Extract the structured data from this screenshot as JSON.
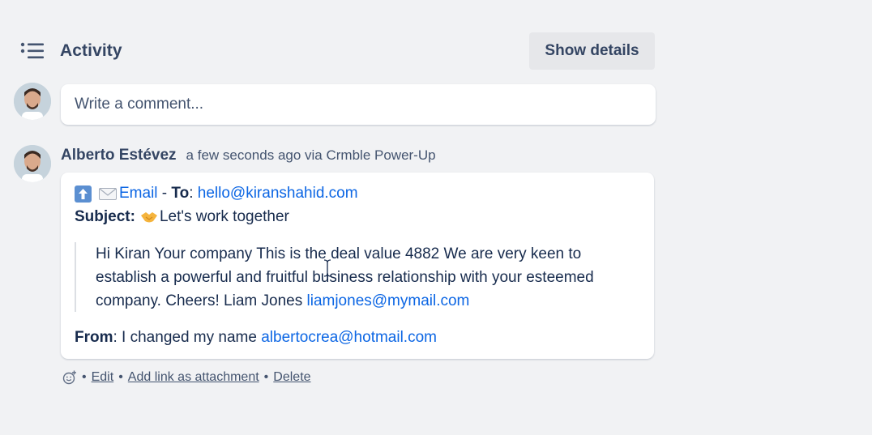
{
  "activity": {
    "title": "Activity",
    "show_details_label": "Show details"
  },
  "comment": {
    "placeholder": "Write a comment..."
  },
  "entry": {
    "author": "Alberto Estévez",
    "timestamp": "a few seconds ago via Crmble Power-Up",
    "email": {
      "type_label": "Email",
      "to_separator": " - ",
      "to_label": "To",
      "to_address": "hello@kiranshahid.com",
      "subject_label": "Subject",
      "subject_text": "Let's work together",
      "body_text": "Hi Kiran Your company This is the deal value 4882 We are very keen to establish a powerful and fruitful business relationship with your esteemed company. Cheers! Liam Jones ",
      "body_link": "liamjones@mymail.com",
      "from_label": "From",
      "from_text": " I changed my name ",
      "from_address": "albertocrea@hotmail.com"
    },
    "actions": {
      "edit": "Edit",
      "add_link": "Add link as attachment",
      "delete": "Delete",
      "separator": "•"
    }
  },
  "icons": {
    "activity": "activity-list-icon",
    "upload": "upload-arrow-icon",
    "envelope": "envelope-icon",
    "handshake": "handshake-icon",
    "emoji": "add-reaction-icon",
    "cursor": "text-cursor-icon"
  },
  "colors": {
    "background": "#f1f2f4",
    "link": "#0c66e4",
    "button_bg": "#e6e7ea"
  }
}
